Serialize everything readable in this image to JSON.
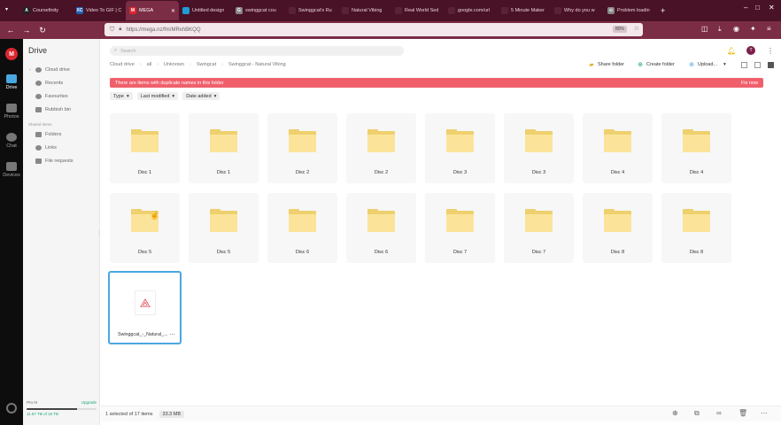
{
  "browser": {
    "tabs": [
      {
        "label": "Coursefinity",
        "fav_color": "#222222",
        "fav_glyph": "A"
      },
      {
        "label": "Video To GIF | C",
        "fav_color": "#1d5fb5",
        "fav_glyph": "XC"
      },
      {
        "label": "MEGA",
        "fav_color": "#d9272e",
        "fav_glyph": "M",
        "active": true
      },
      {
        "label": "Untitled design",
        "fav_color": "#1f9bd6",
        "fav_glyph": ""
      },
      {
        "label": "swinggcat cou",
        "fav_color": "#888888",
        "fav_glyph": "G"
      },
      {
        "label": "Swinggcat's Ru",
        "fav_color": "#5a2238",
        "fav_glyph": ""
      },
      {
        "label": "Natural Vibing",
        "fav_color": "#5a2238",
        "fav_glyph": ""
      },
      {
        "label": "Real World Sed",
        "fav_color": "#5a2238",
        "fav_glyph": ""
      },
      {
        "label": "google.com/url",
        "fav_color": "#5a2238",
        "fav_glyph": ""
      },
      {
        "label": "5 Minute Maker",
        "fav_color": "#5a2238",
        "fav_glyph": ""
      },
      {
        "label": "Why do you w",
        "fav_color": "#5a2238",
        "fav_glyph": ""
      },
      {
        "label": "Problem loadin",
        "fav_color": "#888888",
        "fav_glyph": "⊙"
      }
    ],
    "url": "https://mega.nz/fm/MRxhBKQQ",
    "zoom": "80%"
  },
  "rail": {
    "logo": "M",
    "items": [
      {
        "label": "Drive",
        "active": true
      },
      {
        "label": "Photos"
      },
      {
        "label": "Chat"
      },
      {
        "label": "Devices"
      }
    ]
  },
  "sidebar": {
    "title": "Drive",
    "items": [
      {
        "label": "Cloud drive"
      },
      {
        "label": "Recents"
      },
      {
        "label": "Favourites"
      },
      {
        "label": "Rubbish bin"
      }
    ],
    "shared_heading": "Shared items",
    "shared_items": [
      {
        "label": "Folders"
      },
      {
        "label": "Links"
      },
      {
        "label": "File requests"
      }
    ],
    "plan": {
      "name": "Pro III",
      "upgrade": "Upgrade",
      "usage": "11.57 TB of 16 TB",
      "fraction": 0.72
    }
  },
  "main": {
    "search_placeholder": "Search",
    "breadcrumb": [
      "Cloud drive",
      "all",
      "Unknown",
      "Swingcat",
      "Swinggcat - Natural Vibing"
    ],
    "toolbar": {
      "share": "Share folder",
      "create": "Create folder",
      "upload": "Upload..."
    },
    "banner": {
      "text": "There are items with duplicate names in this folder",
      "action": "Fix now"
    },
    "filters": [
      "Type",
      "Last modified",
      "Date added"
    ],
    "folders": [
      "Disc 1",
      "Disc 1",
      "Disc 2",
      "Disc 2",
      "Disc 3",
      "Disc 3",
      "Disc 4",
      "Disc 4",
      "Disc 5",
      "Disc 5",
      "Disc 6",
      "Disc 6",
      "Disc 7",
      "Disc 7",
      "Disc 8",
      "Disc 8"
    ],
    "file": {
      "name": "Swinggcat_-_Natural_..."
    },
    "status": {
      "selection": "1 selected of 17 items",
      "size": "33.3 MB"
    }
  },
  "colors": {
    "accent": "#4aa8e0",
    "banner": "#f0606c",
    "brand": "#d9272e",
    "browser": "#7b2d45"
  }
}
